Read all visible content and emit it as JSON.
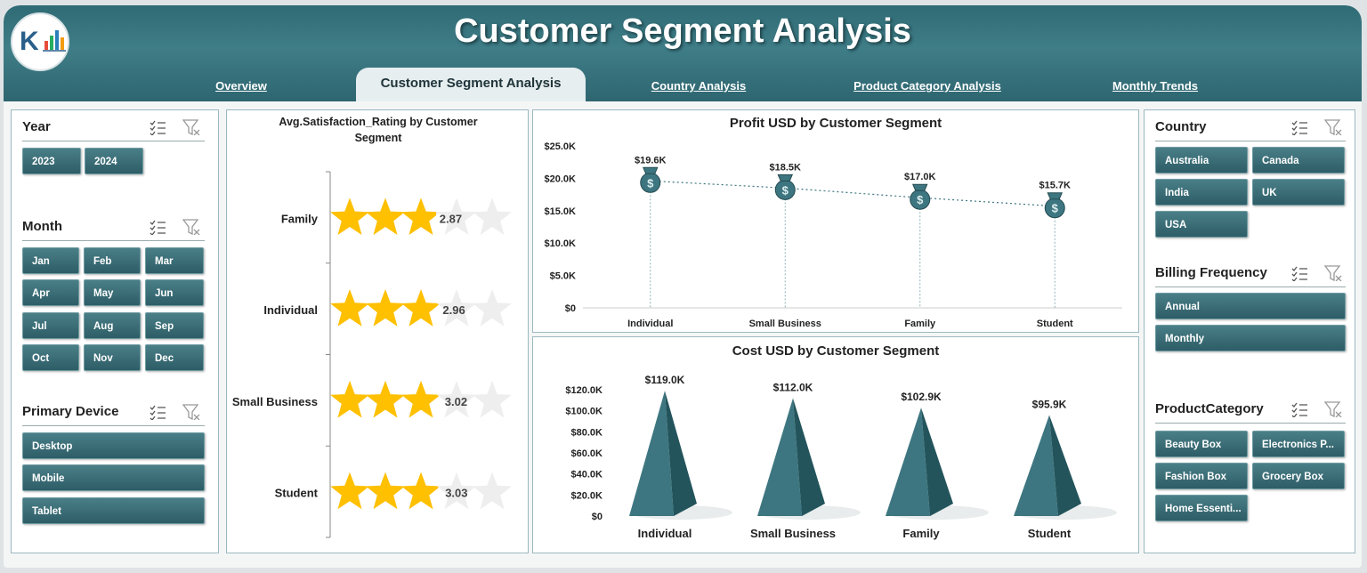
{
  "header": {
    "title": "Customer Segment Analysis",
    "tabs": [
      {
        "label": "Overview"
      },
      {
        "label": "Customer Segment Analysis"
      },
      {
        "label": "Country Analysis"
      },
      {
        "label": "Product Category Analysis"
      },
      {
        "label": "Monthly Trends"
      }
    ]
  },
  "slicers": {
    "year": {
      "title": "Year",
      "items": [
        "2023",
        "2024"
      ]
    },
    "month": {
      "title": "Month",
      "items": [
        "Jan",
        "Feb",
        "Mar",
        "Apr",
        "May",
        "Jun",
        "Jul",
        "Aug",
        "Sep",
        "Oct",
        "Nov",
        "Dec"
      ]
    },
    "device": {
      "title": "Primary Device",
      "items": [
        "Desktop",
        "Mobile",
        "Tablet"
      ]
    },
    "country": {
      "title": "Country",
      "items": [
        "Australia",
        "Canada",
        "India",
        "UK",
        "USA"
      ]
    },
    "billing": {
      "title": "Billing Frequency",
      "items": [
        "Annual",
        "Monthly"
      ]
    },
    "product": {
      "title": "ProductCategory",
      "items": [
        "Beauty Box",
        "Electronics P...",
        "Fashion Box",
        "Grocery Box",
        "Home Essenti..."
      ]
    }
  },
  "colors": {
    "accent": "#2f6b75",
    "star": "#ffc000",
    "bar": "#3d7680"
  },
  "chart_data": [
    {
      "type": "bar",
      "title": "Avg.Satisfaction_Rating by Customer Segment",
      "categories": [
        "Family",
        "Individual",
        "Small Business",
        "Student"
      ],
      "values": [
        2.87,
        2.96,
        3.02,
        3.03
      ],
      "labels": [
        "2.87",
        "2.96",
        "3.02",
        "3.03"
      ],
      "max_rating": 5
    },
    {
      "type": "line",
      "title": "Profit USD by Customer Segment",
      "categories": [
        "Individual",
        "Small Business",
        "Family",
        "Student"
      ],
      "values": [
        19600,
        18500,
        17000,
        15700
      ],
      "labels": [
        "$19.6K",
        "$18.5K",
        "$17.0K",
        "$15.7K"
      ],
      "yticks": [
        "$0",
        "$5.0K",
        "$10.0K",
        "$15.0K",
        "$20.0K",
        "$25.0K"
      ],
      "ylim": [
        0,
        25000
      ]
    },
    {
      "type": "bar",
      "title": "Cost USD by Customer Segment",
      "categories": [
        "Individual",
        "Small Business",
        "Family",
        "Student"
      ],
      "values": [
        119000,
        112000,
        102900,
        95900
      ],
      "labels": [
        "$119.0K",
        "$112.0K",
        "$102.9K",
        "$95.9K"
      ],
      "yticks": [
        "$0",
        "$20.0K",
        "$40.0K",
        "$60.0K",
        "$80.0K",
        "$100.0K",
        "$120.0K"
      ],
      "ylim": [
        0,
        120000
      ]
    }
  ]
}
